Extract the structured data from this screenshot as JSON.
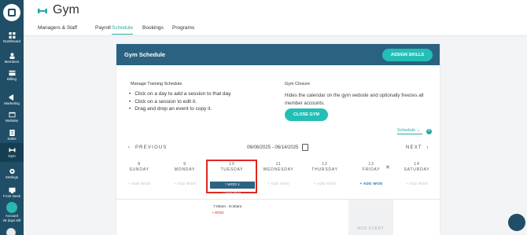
{
  "sidebar": {
    "items": [
      {
        "label": "Dashboard",
        "icon": "dashboard-icon"
      },
      {
        "label": "Members",
        "icon": "members-icon"
      },
      {
        "label": "Billing",
        "icon": "billing-icon"
      },
      {
        "label": "Marketing",
        "icon": "marketing-icon"
      },
      {
        "label": "Website",
        "icon": "website-icon"
      },
      {
        "label": "Sales",
        "icon": "sales-icon"
      },
      {
        "label": "Gym",
        "icon": "gym-icon"
      },
      {
        "label": "Settings",
        "icon": "settings-icon"
      },
      {
        "label": "Front Desk",
        "icon": "front-desk-icon"
      }
    ],
    "account": {
      "label": "Account",
      "sub": "28 days left"
    }
  },
  "header": {
    "title": "Gym"
  },
  "tabs": [
    "Managers & Staff",
    "Payroll",
    "Schedule",
    "Bookings",
    "Programs"
  ],
  "card": {
    "title": "Gym Schedule",
    "assign_skills": "ASSIGN SKILLS",
    "manage": {
      "title": "Manage Training Schedule",
      "bullets": [
        "Click on a day to add a session to that day.",
        "Click on a session to edit it.",
        "Drag and drop an event to copy it."
      ]
    },
    "closure": {
      "title": "Gym Closure",
      "desc": "Hides the calendar on the gym website and optionally freezes all member accounts.",
      "button": "CLOSE GYM"
    },
    "schedule_dropdown": "Schedule",
    "prev": "PREVIOUS",
    "next": "NEXT",
    "date_range": "06/08/2025 - 06/14/2025",
    "days": [
      {
        "num": "8",
        "name": "SUNDAY",
        "add": "+ ADD WOD"
      },
      {
        "num": "9",
        "name": "MONDAY",
        "add": "+ ADD WOD"
      },
      {
        "num": "10",
        "name": "TUESDAY",
        "add": "+ ADD WOD"
      },
      {
        "num": "11",
        "name": "WEDNESDAY",
        "add": "+ ADD WOD"
      },
      {
        "num": "12",
        "name": "THURSDAY",
        "add": "+ ADD WOD"
      },
      {
        "num": "13",
        "name": "FRIDAY",
        "add": "+ ADD WOD"
      },
      {
        "num": "14",
        "name": "SATURDAY",
        "add": "+ ADD WOD"
      }
    ],
    "wod_label": "WOD 1",
    "session": {
      "time": "7:00am - 8:30am",
      "name": "WOD"
    },
    "add_event": "ADD EVENT"
  },
  "colors": {
    "sidebar": "#1f4e66",
    "header": "#2b6281",
    "accent": "#23bfb7",
    "highlight": "#e0281f"
  }
}
